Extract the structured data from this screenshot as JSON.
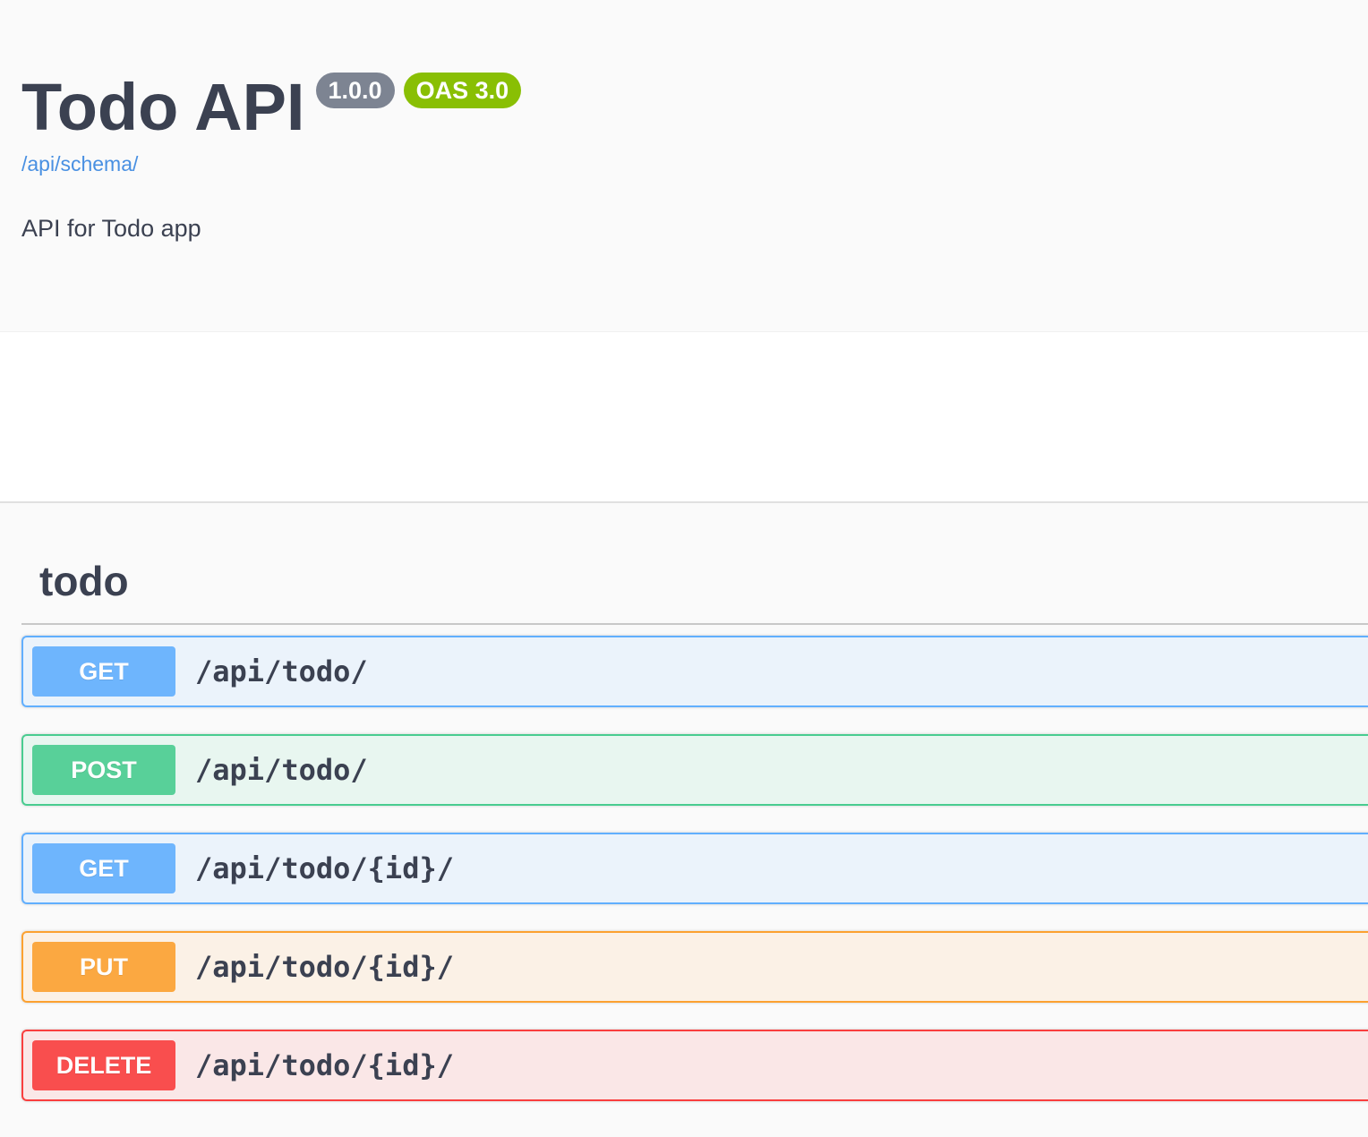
{
  "info": {
    "title": "Todo API",
    "version": "1.0.0",
    "oas": "OAS 3.0",
    "schema_link": "/api/schema/",
    "description": "API for Todo app"
  },
  "colors": {
    "get": "#61affe",
    "post": "#49cc90",
    "put": "#fca130",
    "delete": "#f93e3e",
    "link": "#4990e2",
    "version_badge": "#7d8492",
    "oas_badge": "#89bf04"
  },
  "tag": {
    "name": "todo",
    "operations": [
      {
        "method": "GET",
        "path": "/api/todo/"
      },
      {
        "method": "POST",
        "path": "/api/todo/"
      },
      {
        "method": "GET",
        "path": "/api/todo/{id}/"
      },
      {
        "method": "PUT",
        "path": "/api/todo/{id}/"
      },
      {
        "method": "DELETE",
        "path": "/api/todo/{id}/"
      }
    ]
  }
}
